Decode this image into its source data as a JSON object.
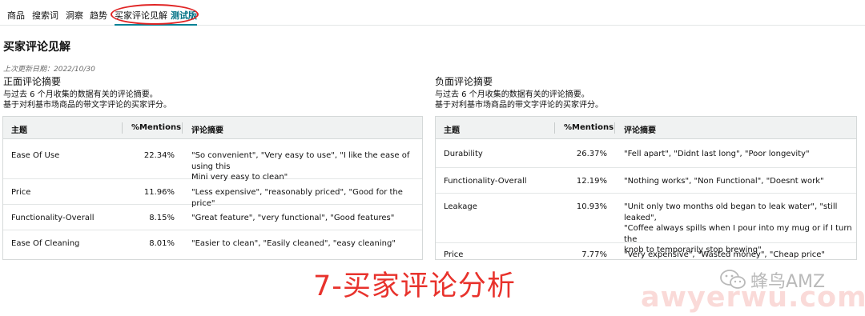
{
  "nav": {
    "items": [
      {
        "label": "商品"
      },
      {
        "label": "搜索词"
      },
      {
        "label": "洞察"
      },
      {
        "label": "趋势"
      },
      {
        "label": "买家评论见解",
        "badge": "测试版"
      }
    ]
  },
  "page": {
    "title": "买家评论见解",
    "updated": "上次更新日期：2022/10/30"
  },
  "positive": {
    "title": "正面评论摘要",
    "desc1": "与过去 6 个月收集的数据有关的评论摘要。",
    "desc2": "基于对利基市场商品的带文字评论的买家评分。",
    "columns": {
      "topic": "主题",
      "mentions": "%Mentions",
      "summary": "评论摘要"
    },
    "rows": [
      {
        "topic": "Ease Of Use",
        "mentions": "22.34%",
        "summary1": "\"So convenient\", \"Very easy to use\", \"I like the ease of using this",
        "summary2": "Mini very easy to clean\"",
        "summary3": ""
      },
      {
        "topic": "Price",
        "mentions": "11.96%",
        "summary1": "\"Less expensive\", \"reasonably priced\", \"Good for the price\"",
        "summary2": "",
        "summary3": ""
      },
      {
        "topic": "Functionality-Overall",
        "mentions": "8.15%",
        "summary1": "\"Great feature\", \"very functional\", \"Good features\"",
        "summary2": "",
        "summary3": ""
      },
      {
        "topic": "Ease Of Cleaning",
        "mentions": "8.01%",
        "summary1": "\"Easier to clean\", \"Easily cleaned\", \"easy cleaning\"",
        "summary2": "",
        "summary3": ""
      }
    ]
  },
  "negative": {
    "title": "负面评论摘要",
    "desc1": "与过去 6 个月收集的数据有关的评论摘要。",
    "desc2": "基于对利基市场商品的带文字评论的买家评分。",
    "columns": {
      "topic": "主题",
      "mentions": "%Mentions",
      "summary": "评论摘要"
    },
    "rows": [
      {
        "topic": "Durability",
        "mentions": "26.37%",
        "summary1": "\"Fell apart\", \"Didnt last long\", \"Poor longevity\"",
        "summary2": "",
        "summary3": ""
      },
      {
        "topic": "Functionality-Overall",
        "mentions": "12.19%",
        "summary1": "\"Nothing works\", \"Non Functional\", \"Doesnt work\"",
        "summary2": "",
        "summary3": ""
      },
      {
        "topic": "Leakage",
        "mentions": "10.93%",
        "summary1": "\"Unit only two months old began to leak water\", \"still leaked\",",
        "summary2": "\"Coffee always spills when I pour into my mug or if I turn the",
        "summary3": "knob to temporarily stop brewing\""
      },
      {
        "topic": "Price",
        "mentions": "7.77%",
        "summary1": "\"Very expensive\", \"Wasted money\", \"Cheap price\"",
        "summary2": "",
        "summary3": ""
      }
    ]
  },
  "overlay": {
    "banner": "7-买家评论分析",
    "watermark_name": "蜂鸟AMZ",
    "watermark_site": "awyerwu.com",
    "annotation_color": "#e02424"
  }
}
